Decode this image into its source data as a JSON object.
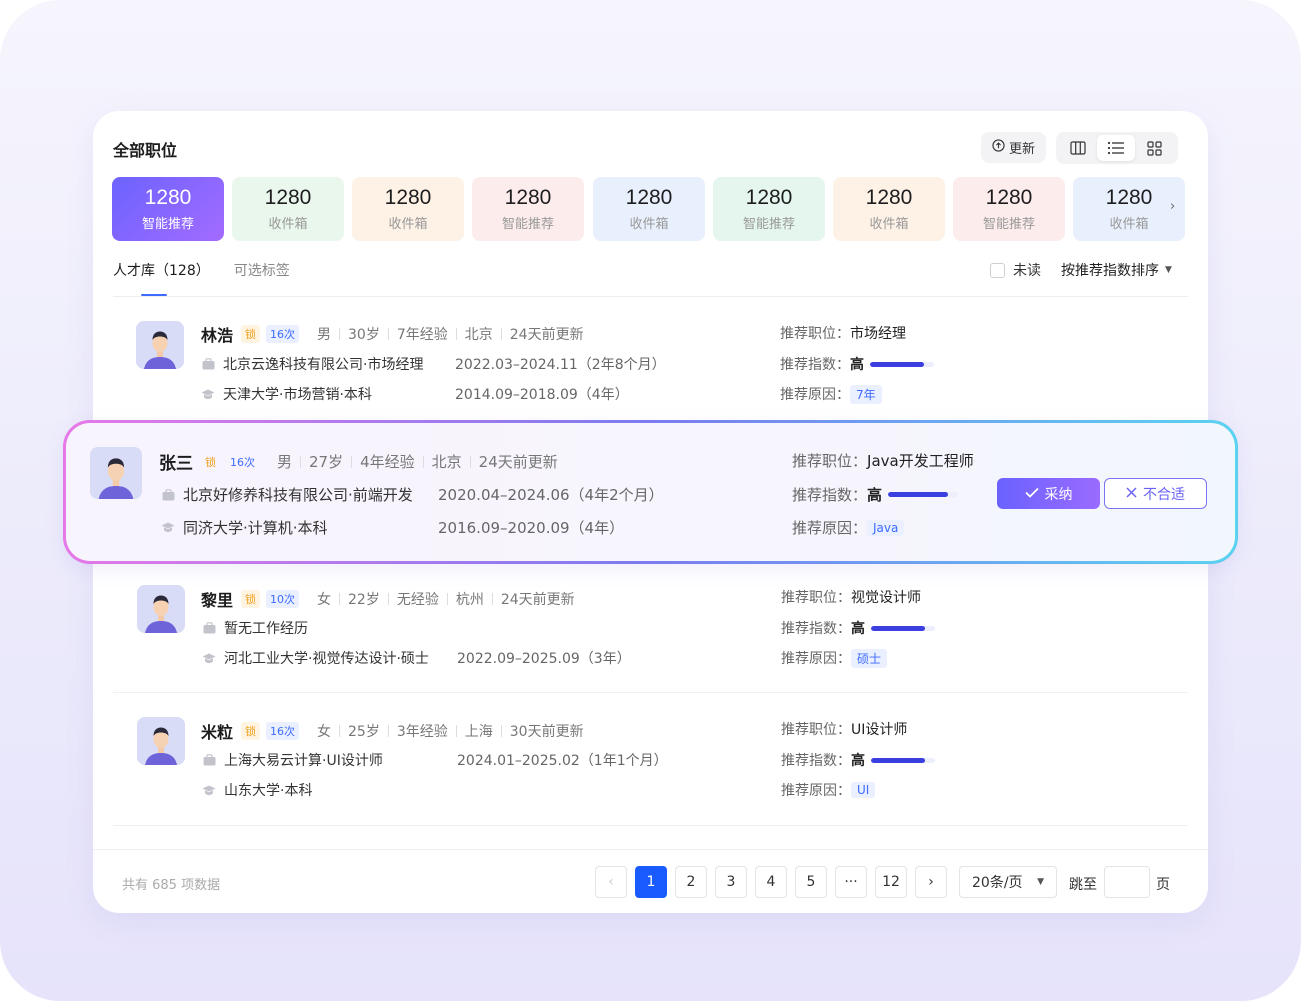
{
  "header": {
    "title": "全部职位",
    "update_label": "更新"
  },
  "stats": [
    {
      "count": "1280",
      "label": "智能推荐",
      "bg": "active"
    },
    {
      "count": "1280",
      "label": "收件箱",
      "bg": "#eaf7ec"
    },
    {
      "count": "1280",
      "label": "收件箱",
      "bg": "#fdf2e5"
    },
    {
      "count": "1280",
      "label": "智能推荐",
      "bg": "#fcecec"
    },
    {
      "count": "1280",
      "label": "收件箱",
      "bg": "#e8effd"
    },
    {
      "count": "1280",
      "label": "智能推荐",
      "bg": "#e5f6ee"
    },
    {
      "count": "1280",
      "label": "收件箱",
      "bg": "#fdf2e5"
    },
    {
      "count": "1280",
      "label": "智能推荐",
      "bg": "#fcecec"
    },
    {
      "count": "1280",
      "label": "收件箱",
      "bg": "#e8effd"
    }
  ],
  "tabs": {
    "talent": "人才库（128）",
    "tags": "可选标签"
  },
  "filters": {
    "unread": "未读",
    "sort": "按推荐指数排序"
  },
  "labels": {
    "position": "推荐职位：",
    "index": "推荐指数：",
    "reason": "推荐原因：",
    "lock": "锁",
    "accept": "采纳",
    "reject": "不合适"
  },
  "candidates": [
    {
      "name": "林浩",
      "times": "16次",
      "gender": "男",
      "age": "30岁",
      "exp": "7年经验",
      "city": "北京",
      "updated": "24天前更新",
      "work": "北京云逸科技有限公司·市场经理",
      "work_period": "2022.03–2024.11（2年8个月）",
      "edu": "天津大学·市场营销·本科",
      "edu_period": "2014.09–2018.09（4年）",
      "position": "市场经理",
      "index": "高",
      "index_level": 0.85,
      "reason": "7年"
    },
    {
      "name": "张三",
      "times": "16次",
      "gender": "男",
      "age": "27岁",
      "exp": "4年经验",
      "city": "北京",
      "updated": "24天前更新",
      "work": "北京好修养科技有限公司·前端开发",
      "work_period": "2020.04–2024.06（4年2个月）",
      "edu": "同济大学·计算机·本科",
      "edu_period": "2016.09–2020.09（4年）",
      "position": "Java开发工程师",
      "index": "高",
      "index_level": 0.85,
      "reason": "Java"
    },
    {
      "name": "黎里",
      "times": "10次",
      "gender": "女",
      "age": "22岁",
      "exp": "无经验",
      "city": "杭州",
      "updated": "24天前更新",
      "work": "暂无工作经历",
      "work_period": "",
      "edu": "河北工业大学·视觉传达设计·硕士",
      "edu_period": "2022.09–2025.09（3年）",
      "position": "视觉设计师",
      "index": "高",
      "index_level": 0.85,
      "reason": "硕士"
    },
    {
      "name": "米粒",
      "times": "16次",
      "gender": "女",
      "age": "25岁",
      "exp": "3年经验",
      "city": "上海",
      "updated": "30天前更新",
      "work": "上海大易云计算·UI设计师",
      "work_period": "2024.01–2025.02（1年1个月）",
      "edu": "山东大学·本科",
      "edu_period": "",
      "position": "UI设计师",
      "index": "高",
      "index_level": 0.85,
      "reason": "UI"
    }
  ],
  "pagination": {
    "total": "共有 685 项数据",
    "pages": [
      "1",
      "2",
      "3",
      "4",
      "5",
      "···",
      "12"
    ],
    "current": "1",
    "page_size": "20条/页",
    "jump_label": "跳至",
    "jump_suffix": "页"
  }
}
